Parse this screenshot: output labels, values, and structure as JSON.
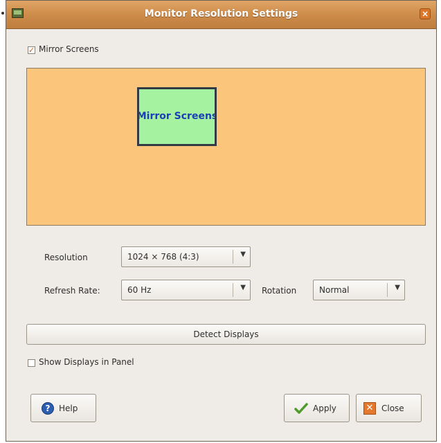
{
  "window": {
    "title": "Monitor Resolution Settings",
    "close_glyph": "×"
  },
  "mirror": {
    "checked": true,
    "check_glyph": "✓",
    "label": "Mirror Screens"
  },
  "preview": {
    "monitor_label": "Mirror Screens",
    "background_color": "#fbc67c",
    "monitor_color": "#a5f2a0"
  },
  "resolution": {
    "label": "Resolution",
    "value": "1024 × 768 (4:3)"
  },
  "refresh_rate": {
    "label": "Refresh Rate:",
    "value": "60 Hz"
  },
  "rotation": {
    "label": "Rotation",
    "value": "Normal"
  },
  "detect_button": {
    "label": "Detect Displays"
  },
  "show_panel": {
    "checked": false,
    "label": "Show Displays in Panel"
  },
  "buttons": {
    "help": "Help",
    "apply": "Apply",
    "close": "Close"
  },
  "icons": {
    "help": "help-icon",
    "apply": "checkmark-icon",
    "close": "close-icon"
  }
}
